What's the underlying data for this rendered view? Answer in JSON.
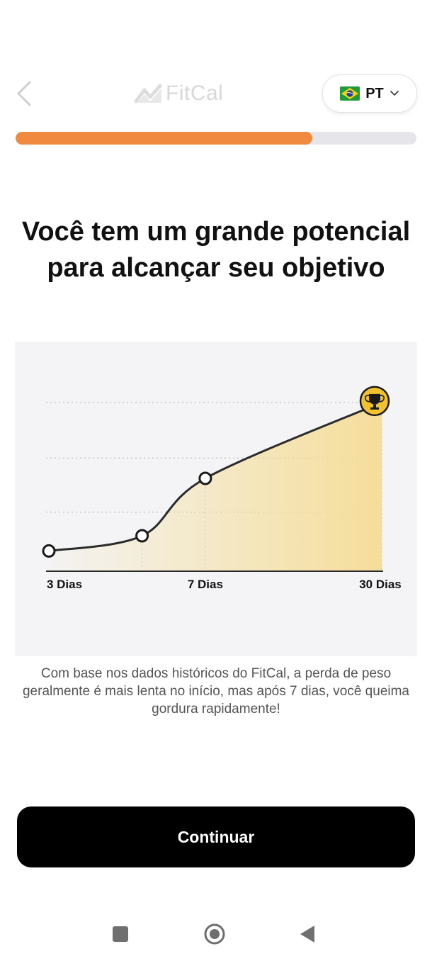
{
  "header": {
    "brand": "FitCal",
    "language": {
      "code": "PT",
      "flag": "brazil-flag-icon"
    }
  },
  "progress": {
    "value": 0.74,
    "color": "#f08a3e"
  },
  "headline": "Você tem um grande potencial para alcançar seu objetivo",
  "chart_data": {
    "type": "area",
    "categories": [
      "3 Dias",
      "7 Dias",
      "30 Dias"
    ],
    "x_tick_labels": [
      "3 Dias",
      "7 Dias",
      "30 Dias"
    ],
    "x": [
      0,
      0.28,
      0.47,
      1.0
    ],
    "y": [
      0.12,
      0.21,
      0.55,
      1.0
    ],
    "ylim": [
      0,
      1.1
    ],
    "grid": "dotted horizontal",
    "goal_icon": "trophy-icon",
    "colors": {
      "line": "#2b2b2b",
      "fill": "#f5dc95",
      "goal": "#f2c12e"
    },
    "title": "",
    "xlabel": "",
    "ylabel": ""
  },
  "caption": "Com base nos dados históricos do FitCal, a perda de peso geralmente é mais lenta no início, mas após 7 dias, você queima gordura rapidamente!",
  "cta": {
    "label": "Continuar"
  },
  "colors": {
    "accent": "#f08a3e",
    "button_bg": "#000000"
  }
}
